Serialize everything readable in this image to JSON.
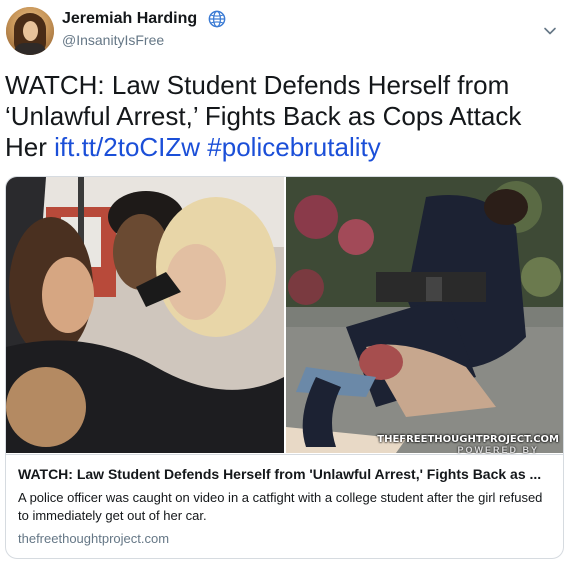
{
  "user": {
    "display_name": "Jeremiah Harding",
    "handle": "@InsanityIsFree",
    "avatar_icon": "avatar",
    "badge_icon": "globe-icon"
  },
  "tweet": {
    "text": "WATCH: Law Student Defends Herself from ‘Unlawful Arrest,’ Fights Back as Cops Attack Her",
    "link": "ift.tt/2toCIZw",
    "hashtag": "#policebrutality"
  },
  "card": {
    "title": "WATCH: Law Student Defends Herself from 'Unlawful Arrest,' Fights Back as ...",
    "description": "A police officer was caught on video in a catfight with a college student after the girl refused to immediately get out of her car.",
    "domain": "thefreethoughtproject.com",
    "watermark": "THEFREETHOUGHTPROJECT.COM",
    "watermark_sub": "POWERED BY"
  },
  "colors": {
    "link": "#1b4fd8",
    "secondary_text": "#657786",
    "border": "#d6dbe0"
  }
}
